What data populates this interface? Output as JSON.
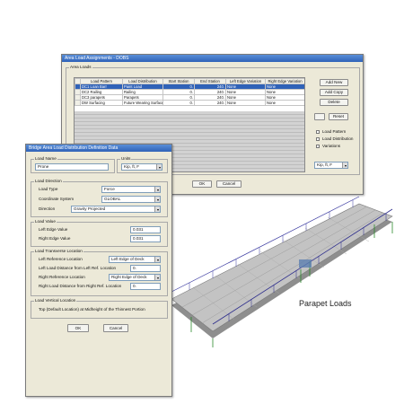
{
  "main_dialog": {
    "title": "Area Load Assignments - DOBS",
    "group_title": "Area Loads",
    "columns": [
      "Load Pattern",
      "Load Distribution",
      "Start Station",
      "End Station",
      "Left Edge Variation",
      "Right Edge Variation"
    ],
    "rows": [
      [
        "DC1 Loan Barr",
        "Paint Load",
        "0.",
        "240.",
        "None",
        "None"
      ],
      [
        "DC2 Railing",
        "Railing",
        "0.",
        "240.",
        "None",
        "None"
      ],
      [
        "DC3 parapets",
        "Parapets",
        "0.",
        "240.",
        "None",
        "None"
      ],
      [
        "DW Surfacing",
        "Future Wearing Surface",
        "0.",
        "240.",
        "None",
        "None"
      ]
    ],
    "buttons": {
      "add_new": "Add New",
      "add_copy": "Add Copy",
      "delete": "Delete",
      "reset": "Reset"
    },
    "side_checks": [
      "Load Pattern",
      "Load Distribution",
      "Variations"
    ],
    "units": "Kip, ft, F",
    "ok": "OK",
    "cancel": "Cancel"
  },
  "sub_dialog": {
    "title": "Bridge Area Load Distribution Definition Data",
    "load_name_group": "Load Name",
    "load_name_value": "Prone",
    "units_group": "Units",
    "units_value": "Kip, ft, F",
    "load_direction_group": "Load Direction",
    "load_type_label": "Load Type",
    "load_type_value": "Force",
    "coord_label": "Coordinate System",
    "coord_value": "GLOBAL",
    "direction_label": "Direction",
    "direction_value": "Gravity Projected",
    "load_value_group": "Load Value",
    "left_edge_label": "Left Edge Value",
    "left_edge_value": "0.031",
    "right_edge_label": "Right Edge Value",
    "right_edge_value": "0.031",
    "transverse_group": "Load Transverse Location",
    "left_ref_label": "Left Reference Location",
    "left_ref_value": "Left Edge of Deck",
    "left_dist_label": "Left Load Distance from Left Ref. Location",
    "left_dist_value": "0.",
    "right_ref_label": "Right Reference Location",
    "right_ref_value": "Right Edge of Deck",
    "right_dist_label": "Right Load Distance from Right Ref. Location",
    "right_dist_value": "0.",
    "vertical_group": "Load Vertical Location",
    "vertical_text": "Top (Default Location) at Midheight of the Thinnest Portion",
    "ok": "OK",
    "cancel": "Cancel"
  },
  "caption": "Parapet Loads"
}
